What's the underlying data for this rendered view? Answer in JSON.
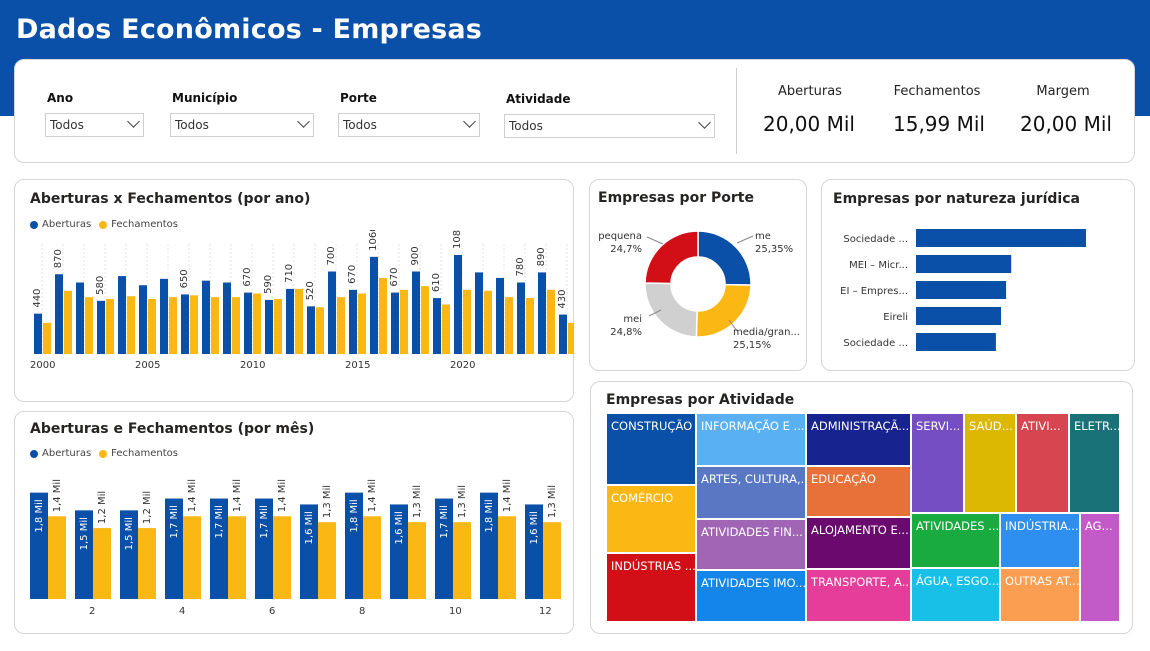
{
  "header": {
    "title": "Dados Econômicos - Empresas"
  },
  "filters": [
    {
      "label": "Ano",
      "value": "Todos"
    },
    {
      "label": "Município",
      "value": "Todos"
    },
    {
      "label": "Porte",
      "value": "Todos"
    },
    {
      "label": "Atividade",
      "value": "Todos"
    }
  ],
  "kpis": [
    {
      "label": "Aberturas",
      "value": "20,00 Mil"
    },
    {
      "label": "Fechamentos",
      "value": "15,99 Mil"
    },
    {
      "label": "Margem",
      "value": "20,00 Mil"
    }
  ],
  "colors": {
    "header": "#0a4fa8",
    "aberturas": "#0a4fa8",
    "fechamentos": "#fbb713"
  },
  "chart_data": [
    {
      "type": "bar",
      "title": "Aberturas x Fechamentos (por ano)",
      "legend": [
        "Aberturas",
        "Fechamentos"
      ],
      "x": [
        2000,
        2001,
        2002,
        2003,
        2004,
        2005,
        2006,
        2007,
        2008,
        2009,
        2010,
        2011,
        2012,
        2013,
        2014,
        2015,
        2016,
        2017,
        2018,
        2019,
        2020,
        2021,
        2022,
        2023,
        2024
      ],
      "x_tick_labels": [
        "2000",
        "2005",
        "2010",
        "2015",
        "2020"
      ],
      "series": [
        {
          "name": "Aberturas",
          "values": [
            440,
            870,
            780,
            580,
            850,
            750,
            820,
            650,
            800,
            780,
            670,
            590,
            710,
            520,
            900,
            700,
            1060,
            670,
            900,
            610,
            1080,
            890,
            830,
            780,
            890,
            430
          ],
          "labels": [
            "440",
            "870",
            "",
            "580",
            "",
            "",
            "",
            "650",
            "",
            "",
            "670",
            "590",
            "710",
            "520",
            "700",
            "670",
            "1060",
            "670",
            "900",
            "610",
            "1080",
            "",
            "",
            "780",
            "890",
            "430"
          ]
        },
        {
          "name": "Fechamentos",
          "values": [
            340,
            690,
            620,
            600,
            630,
            600,
            620,
            640,
            620,
            620,
            660,
            600,
            710,
            510,
            620,
            660,
            830,
            700,
            740,
            540,
            700,
            690,
            620,
            610,
            700,
            340
          ]
        }
      ]
    },
    {
      "type": "bar",
      "title": "Aberturas e Fechamentos (por mês)",
      "legend": [
        "Aberturas",
        "Fechamentos"
      ],
      "categories": [
        "1",
        "2",
        "3",
        "4",
        "5",
        "6",
        "7",
        "8",
        "9",
        "10",
        "11",
        "12"
      ],
      "x_tick_labels": [
        "2",
        "4",
        "6",
        "8",
        "10",
        "12"
      ],
      "series": [
        {
          "name": "Aberturas",
          "values": [
            1.8,
            1.5,
            1.5,
            1.7,
            1.7,
            1.7,
            1.6,
            1.8,
            1.6,
            1.7,
            1.8,
            1.6
          ],
          "labels": [
            "1,8 Mil",
            "1,5 Mil",
            "1,5 Mil",
            "1,7 Mil",
            "1,7 Mil",
            "1,7 Mil",
            "1,6 Mil",
            "1,8 Mil",
            "1,6 Mil",
            "1,7 Mil",
            "1,8 Mil",
            "1,6 Mil"
          ]
        },
        {
          "name": "Fechamentos",
          "values": [
            1.4,
            1.2,
            1.2,
            1.4,
            1.4,
            1.4,
            1.3,
            1.4,
            1.3,
            1.3,
            1.4,
            1.3
          ],
          "labels": [
            "1,4 Mil",
            "1,2 Mil",
            "1,2 Mil",
            "1,4 Mil",
            "1,4 Mil",
            "1,4 Mil",
            "1,3 Mil",
            "1,4 Mil",
            "1,3 Mil",
            "1,3 Mil",
            "1,4 Mil",
            "1,3 Mil"
          ]
        }
      ]
    },
    {
      "type": "pie",
      "title": "Empresas por Porte",
      "slices": [
        {
          "name": "me",
          "label": "25,35%",
          "value": 25.35,
          "color": "#0a4fa8"
        },
        {
          "name": "media/gran...",
          "label": "25,15%",
          "value": 25.15,
          "color": "#fbb713"
        },
        {
          "name": "mei",
          "label": "24,8%",
          "value": 24.8,
          "color": "#d0d0d0"
        },
        {
          "name": "pequena",
          "label": "24,7%",
          "value": 24.7,
          "color": "#d20f16"
        }
      ]
    },
    {
      "type": "bar",
      "title": "Empresas por natureza jurídica",
      "orientation": "horizontal",
      "categories": [
        "Sociedade ...",
        "MEI – Micr...",
        "EI – Empres...",
        "Eireli",
        "Sociedade ..."
      ],
      "values": [
        100,
        56,
        53,
        50,
        47
      ]
    },
    {
      "type": "treemap",
      "title": "Empresas por Atividade",
      "items": [
        {
          "name": "CONSTRUÇÃO",
          "color": "#0a4fa8"
        },
        {
          "name": "COMÉRCIO",
          "color": "#fbb713"
        },
        {
          "name": "INDÚSTRIAS ...",
          "color": "#d20f16"
        },
        {
          "name": "INFORMAÇÃO E ...",
          "color": "#59b1f3"
        },
        {
          "name": "ARTES, CULTURA,...",
          "color": "#5a77c4"
        },
        {
          "name": "ATIVIDADES FIN...",
          "color": "#a066b5"
        },
        {
          "name": "ATIVIDADES IMO...",
          "color": "#1486ea"
        },
        {
          "name": "ADMINISTRAÇÃ...",
          "color": "#17238e"
        },
        {
          "name": "EDUCAÇÃO",
          "color": "#e8713a"
        },
        {
          "name": "ALOJAMENTO E...",
          "color": "#6b0a6e"
        },
        {
          "name": "TRANSPORTE, A...",
          "color": "#e73d9a"
        },
        {
          "name": "SERVI...",
          "color": "#744ec2"
        },
        {
          "name": "SAÚD...",
          "color": "#dcb803"
        },
        {
          "name": "ATIVI...",
          "color": "#d64550"
        },
        {
          "name": "ELETR...",
          "color": "#197278"
        },
        {
          "name": "ATIVIDADES ...",
          "color": "#1aab40"
        },
        {
          "name": "INDÚSTRIA...",
          "color": "#2f8ff0"
        },
        {
          "name": "AG...",
          "color": "#c25bc8"
        },
        {
          "name": "ÁGUA, ESGO...",
          "color": "#18c0e8"
        },
        {
          "name": "OUTRAS AT...",
          "color": "#fb9e52"
        }
      ]
    }
  ]
}
